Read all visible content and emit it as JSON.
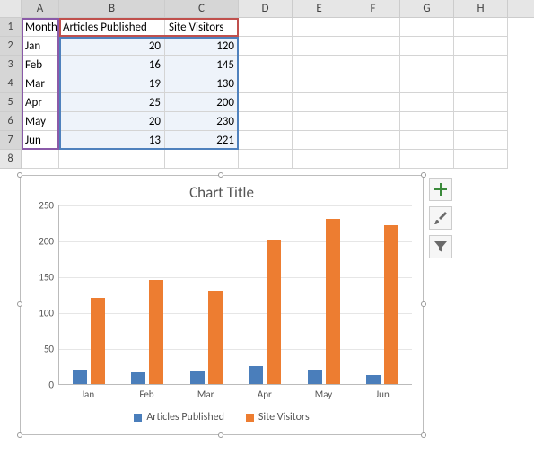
{
  "columns": [
    "A",
    "B",
    "C",
    "D",
    "E",
    "F",
    "G",
    "H"
  ],
  "spreadsheet": {
    "headers": {
      "A": "Month",
      "B": "Articles Published",
      "C": "Site Visitors"
    },
    "rows": [
      {
        "month": "Jan",
        "articles": 20,
        "visitors": 120
      },
      {
        "month": "Feb",
        "articles": 16,
        "visitors": 145
      },
      {
        "month": "Mar",
        "articles": 19,
        "visitors": 130
      },
      {
        "month": "Apr",
        "articles": 25,
        "visitors": 200
      },
      {
        "month": "May",
        "articles": 20,
        "visitors": 230
      },
      {
        "month": "Jun",
        "articles": 13,
        "visitors": 221
      }
    ]
  },
  "chart_data": {
    "type": "bar",
    "title": "Chart Title",
    "categories": [
      "Jan",
      "Feb",
      "Mar",
      "Apr",
      "May",
      "Jun"
    ],
    "series": [
      {
        "name": "Articles Published",
        "values": [
          20,
          16,
          19,
          25,
          20,
          13
        ],
        "color": "#4a7ebb"
      },
      {
        "name": "Site Visitors",
        "values": [
          120,
          145,
          130,
          200,
          230,
          221
        ],
        "color": "#ed7d31"
      }
    ],
    "ylim": [
      0,
      250
    ],
    "yticks": [
      0,
      50,
      100,
      150,
      200,
      250
    ],
    "xlabel": "",
    "ylabel": "",
    "legend_position": "bottom"
  },
  "chart_buttons": {
    "add": "Chart Elements",
    "style": "Chart Styles",
    "filter": "Chart Filters"
  }
}
